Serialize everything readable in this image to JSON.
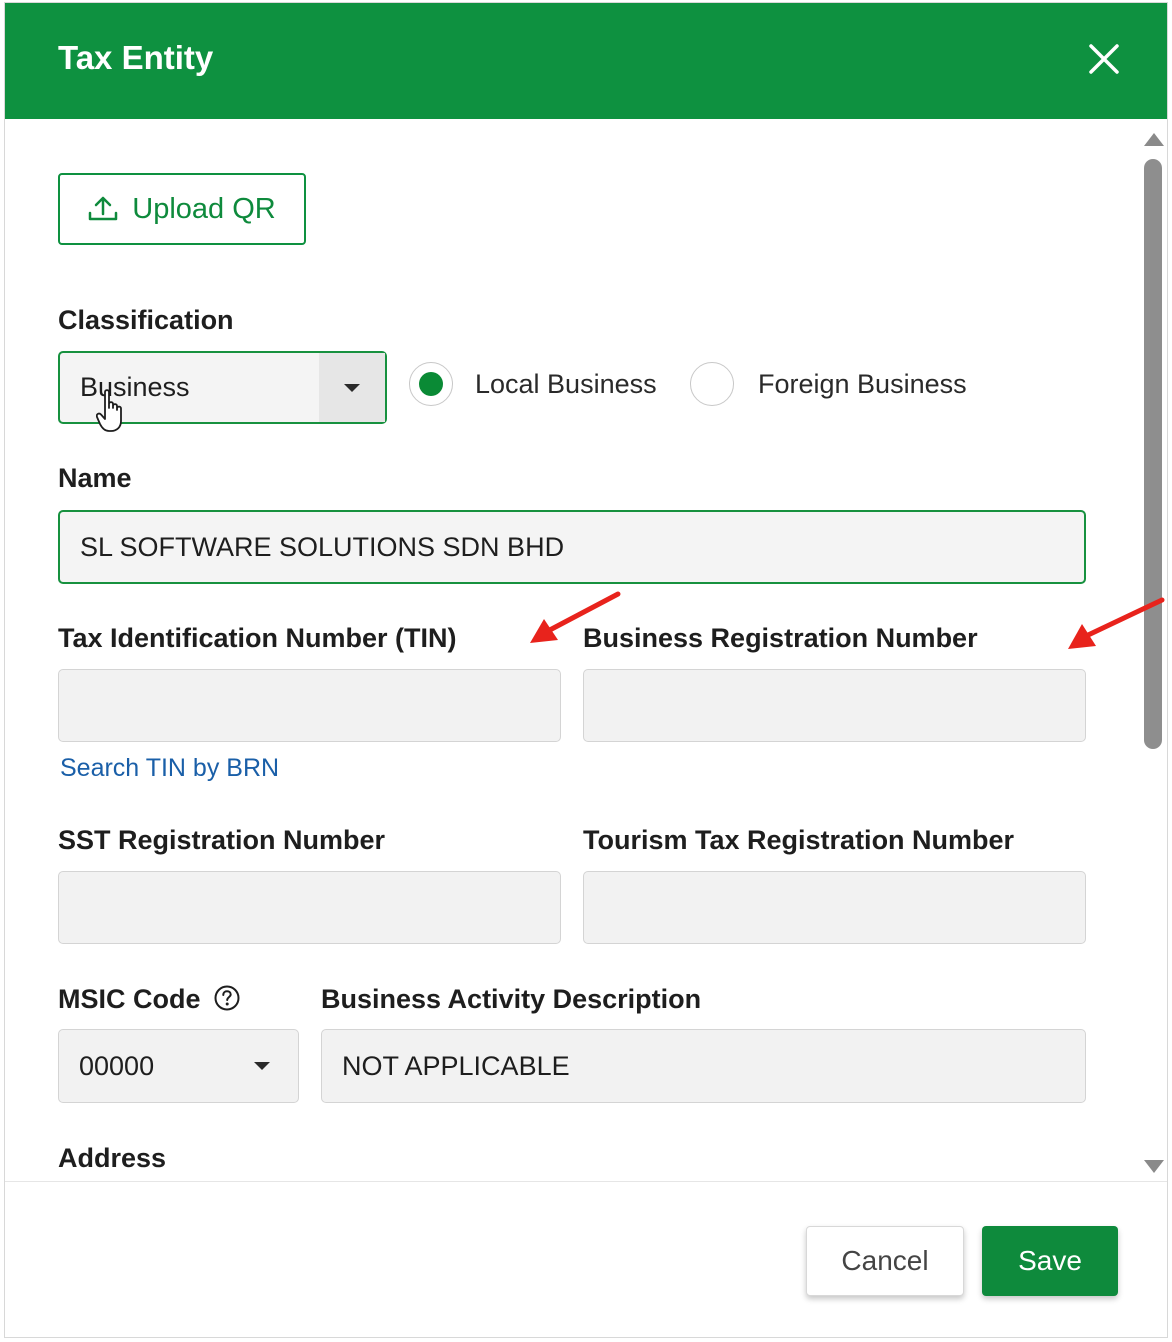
{
  "dialog": {
    "title": "Tax Entity",
    "colors": {
      "header": "#0e9140",
      "accent": "#0e8a3c",
      "link": "#1a5fa8",
      "annotation_arrow": "#e8231c"
    }
  },
  "upload": {
    "label": "Upload QR",
    "icon": "upload-icon"
  },
  "classification": {
    "label": "Classification",
    "selected": "Business",
    "radios": [
      {
        "label": "Local Business",
        "checked": true
      },
      {
        "label": "Foreign Business",
        "checked": false
      }
    ]
  },
  "name": {
    "label": "Name",
    "value": "SL SOFTWARE SOLUTIONS SDN BHD"
  },
  "tin": {
    "label": "Tax Identification Number (TIN)",
    "value": "",
    "link": "Search TIN by BRN"
  },
  "brn": {
    "label": "Business Registration Number",
    "value": ""
  },
  "sst": {
    "label": "SST Registration Number",
    "value": ""
  },
  "tourism": {
    "label": "Tourism Tax Registration Number",
    "value": ""
  },
  "msic": {
    "label": "MSIC Code",
    "value": "00000",
    "help_icon": "question-circle-icon"
  },
  "activity": {
    "label": "Business Activity Description",
    "value": "NOT APPLICABLE"
  },
  "address": {
    "label": "Address"
  },
  "footer": {
    "cancel": "Cancel",
    "save": "Save"
  }
}
